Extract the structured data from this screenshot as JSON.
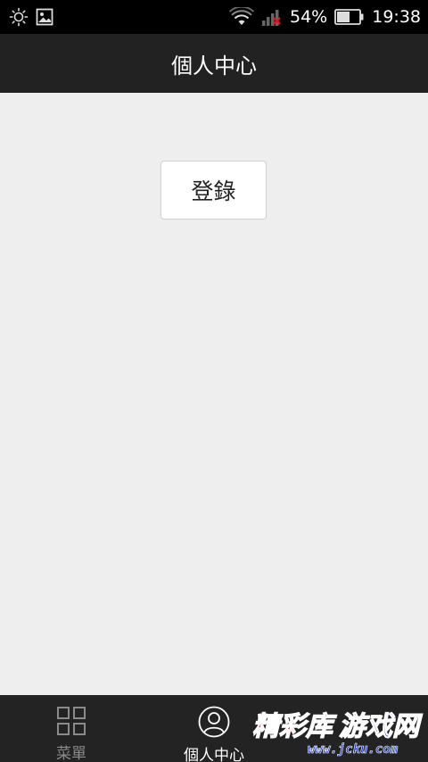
{
  "status_bar": {
    "battery": "54%",
    "time": "19:38",
    "icons": [
      "brightness-icon",
      "image-icon",
      "wifi-icon",
      "signal-no-sim-icon",
      "battery-icon"
    ]
  },
  "header": {
    "title": "個人中心"
  },
  "main": {
    "login_label": "登錄"
  },
  "tab_bar": {
    "tabs": [
      {
        "label": "菜單",
        "icon": "grid-icon",
        "active": false
      },
      {
        "label": "個人中心",
        "icon": "user-icon",
        "active": true
      }
    ]
  },
  "watermark": {
    "title": "精彩库游戏网",
    "url": "www.jcku.com"
  },
  "colors": {
    "status_bar_bg": "#000000",
    "header_bg": "#222222",
    "content_bg": "#eeeeee",
    "tab_bar_bg": "#232323",
    "watermark_red": "#e0161e",
    "watermark_blue": "#1e3cc8"
  }
}
